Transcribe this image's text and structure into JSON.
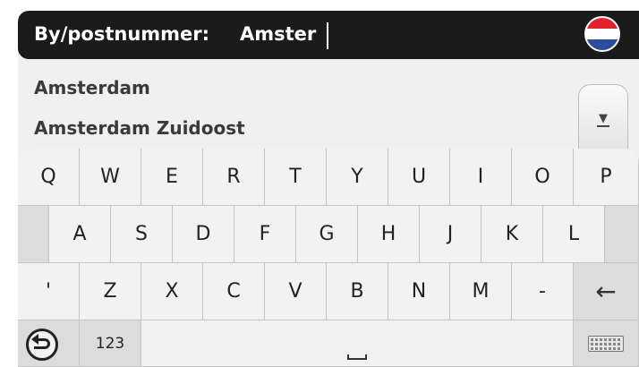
{
  "search": {
    "label": "By/postnummer:",
    "value": "Amster",
    "country_flag_icon": "netherlands-flag-icon"
  },
  "suggestions": [
    "Amsterdam",
    "Amsterdam Zuidoost"
  ],
  "scroll": {
    "icon": "scroll-down-arrow-icon"
  },
  "keyboard": {
    "row1": [
      "Q",
      "W",
      "E",
      "R",
      "T",
      "Y",
      "U",
      "I",
      "O",
      "P"
    ],
    "row2": [
      "A",
      "S",
      "D",
      "F",
      "G",
      "H",
      "J",
      "K",
      "L"
    ],
    "row3": [
      "'",
      "Z",
      "X",
      "C",
      "V",
      "B",
      "N",
      "M",
      "-"
    ],
    "backspace_glyph": "←",
    "numbers_label": "123",
    "back_icon": "back-icon",
    "space_icon": "space-bar-icon",
    "keyboard_icon": "keyboard-layout-icon"
  },
  "colors": {
    "header_bg": "#1b1b1b",
    "keyboard_bg": "#d6d6d6",
    "key_bg": "#f2f2f2"
  }
}
